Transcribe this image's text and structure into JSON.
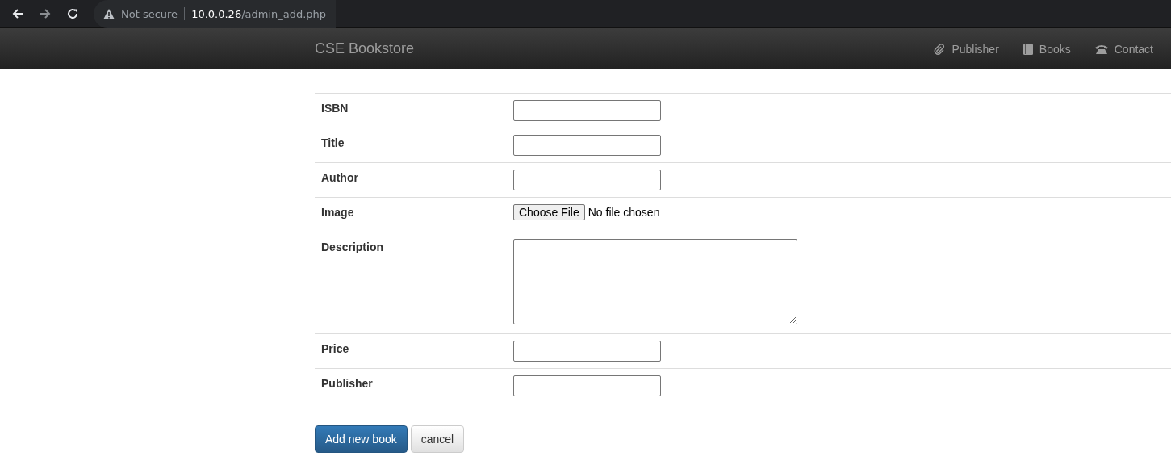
{
  "browser": {
    "security": "Not secure",
    "url_host": "10.0.0.26",
    "url_path": "/admin_add.php"
  },
  "navbar": {
    "brand": "CSE Bookstore",
    "links": [
      {
        "label": "Publisher",
        "kind": "paperclip"
      },
      {
        "label": "Books",
        "kind": "book"
      },
      {
        "label": "Contact",
        "kind": "phone"
      }
    ]
  },
  "form": {
    "fields": [
      {
        "label": "ISBN",
        "kind": "text"
      },
      {
        "label": "Title",
        "kind": "text"
      },
      {
        "label": "Author",
        "kind": "text"
      },
      {
        "label": "Image",
        "kind": "file",
        "button": "Choose File",
        "status": "No file chosen"
      },
      {
        "label": "Description",
        "kind": "textarea"
      },
      {
        "label": "Price",
        "kind": "text"
      },
      {
        "label": "Publisher",
        "kind": "text"
      }
    ]
  },
  "buttons": [
    {
      "label": "Add new book",
      "kind": "primary"
    },
    {
      "label": "cancel",
      "kind": "default"
    }
  ]
}
